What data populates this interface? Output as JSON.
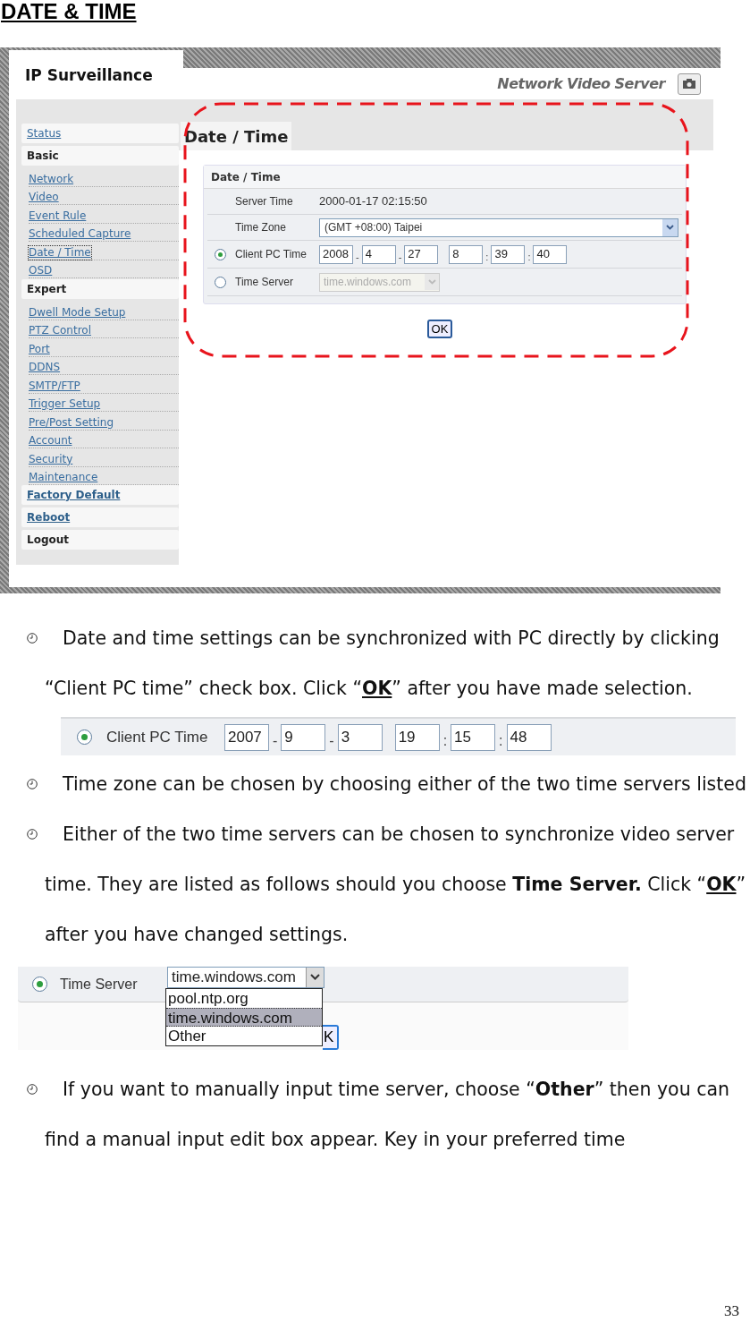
{
  "heading": "DATE & TIME",
  "screenshot": {
    "brand": "IP Surveillance",
    "product": "Network Video Server",
    "menu": [
      {
        "kind": "box-link",
        "label": "Status",
        "selected": false
      },
      {
        "kind": "group",
        "label": "Basic",
        "selected": false
      },
      {
        "kind": "link",
        "label": "Network",
        "selected": false
      },
      {
        "kind": "link",
        "label": "Video",
        "selected": false
      },
      {
        "kind": "link",
        "label": "Event Rule",
        "selected": false
      },
      {
        "kind": "link",
        "label": "Scheduled Capture",
        "selected": false
      },
      {
        "kind": "link",
        "label": "Date / Time",
        "selected": true
      },
      {
        "kind": "link",
        "label": "OSD",
        "selected": false
      },
      {
        "kind": "group",
        "label": "Expert",
        "selected": false
      },
      {
        "kind": "link",
        "label": "Dwell Mode Setup",
        "selected": false
      },
      {
        "kind": "link",
        "label": "PTZ Control",
        "selected": false
      },
      {
        "kind": "link",
        "label": "Port",
        "selected": false
      },
      {
        "kind": "link",
        "label": "DDNS",
        "selected": false
      },
      {
        "kind": "link",
        "label": "SMTP/FTP",
        "selected": false
      },
      {
        "kind": "link",
        "label": "Trigger Setup",
        "selected": false
      },
      {
        "kind": "link",
        "label": "Pre/Post Setting",
        "selected": false
      },
      {
        "kind": "link",
        "label": "Account",
        "selected": false
      },
      {
        "kind": "link",
        "label": "Security",
        "selected": false
      },
      {
        "kind": "link",
        "label": "Maintenance",
        "selected": false
      },
      {
        "kind": "box-action",
        "label": "Factory Default",
        "selected": false
      },
      {
        "kind": "box-action",
        "label": "Reboot",
        "selected": false
      },
      {
        "kind": "group",
        "label": "Logout",
        "selected": false
      }
    ],
    "page_tab": "Date / Time",
    "section_title": "Date / Time",
    "server_time_label": "Server Time",
    "server_time": "2000-01-17 02:15:50",
    "time_zone_label": "Time Zone",
    "time_zone": "(GMT +08:00) Taipei",
    "client_mode": {
      "label": "Client PC Time",
      "selected": true
    },
    "client_time": [
      {
        "value": "2008"
      },
      {
        "sep": "-",
        "value": "4"
      },
      {
        "sep": "-",
        "value": "27"
      },
      {
        "value": "8"
      },
      {
        "sep": ":",
        "value": "39"
      },
      {
        "sep": ":",
        "value": "40"
      }
    ],
    "server_mode": {
      "label": "Time Server",
      "selected": false
    },
    "time_server": {
      "value": "time.windows.com",
      "disabled": true
    },
    "ok": "OK"
  },
  "blocks": [
    {
      "kind": "bullet",
      "segments": [
        {
          "text": "Date and time settings can be synchronized with PC directly by clicking “Client PC time” check box. Click “"
        },
        {
          "text": "OK",
          "bold": true,
          "underline": true
        },
        {
          "text": "” after you have made selection."
        }
      ]
    },
    {
      "kind": "client-snippet",
      "label": "Client PC Time",
      "selected": true,
      "fields": [
        {
          "value": "2007"
        },
        {
          "sep": "-",
          "value": "9"
        },
        {
          "sep": "-",
          "value": "3"
        },
        {
          "value": "19"
        },
        {
          "sep": ":",
          "value": "15"
        },
        {
          "sep": ":",
          "value": "48"
        }
      ]
    },
    {
      "kind": "bullet",
      "segments": [
        {
          "text": "Time zone can be chosen by choosing either of the two time servers listed"
        }
      ]
    },
    {
      "kind": "bullet",
      "segments": [
        {
          "text": "Either of the two time servers can be chosen to synchronize video server time. They are listed as follows should you choose "
        },
        {
          "text": "Time Server.",
          "bold": true
        },
        {
          "text": " Click “"
        },
        {
          "text": "OK",
          "bold": true,
          "underline": true
        },
        {
          "text": "” after you have changed settings."
        }
      ]
    },
    {
      "kind": "server-snippet",
      "label": "Time Server",
      "selected": true,
      "value": "time.windows.com",
      "options": [
        {
          "label": "pool.ntp.org",
          "selected": false
        },
        {
          "label": "time.windows.com",
          "selected": true
        },
        {
          "label": "Other",
          "selected": false
        }
      ],
      "ok": "K"
    },
    {
      "kind": "bullet",
      "segments": [
        {
          "text": "If you want to manually input time server, choose “"
        },
        {
          "text": "Other",
          "bold": true
        },
        {
          "text": "” then you can find a manual input edit box appear. Key in your preferred time"
        }
      ]
    }
  ],
  "page_number": "33"
}
